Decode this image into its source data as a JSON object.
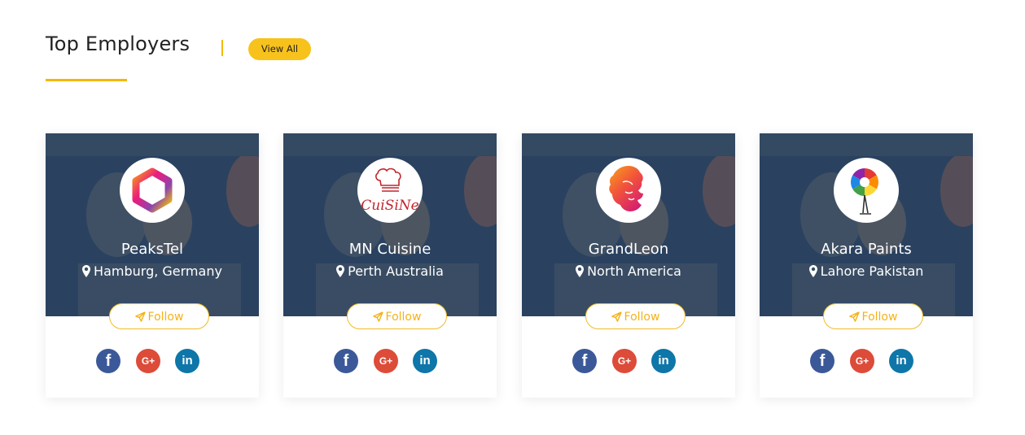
{
  "section": {
    "title": "Top Employers",
    "view_all_label": "View All",
    "accent_color": "#f5b800"
  },
  "employers": [
    {
      "name": "PeaksTel",
      "location": "Hamburg, Germany",
      "logo_icon": "hexagon-gradient-logo",
      "follow_label": "Follow"
    },
    {
      "name": "MN Cuisine",
      "location": "Perth Australia",
      "logo_icon": "chef-hat-cuisine-logo",
      "logo_text": "CuiSiNe",
      "follow_label": "Follow"
    },
    {
      "name": "GrandLeon",
      "location": "North America",
      "logo_icon": "lion-head-logo",
      "follow_label": "Follow"
    },
    {
      "name": "Akara Paints",
      "location": "Lahore Pakistan",
      "logo_icon": "color-wheel-flamingo-logo",
      "follow_label": "Follow"
    }
  ],
  "social": {
    "facebook_glyph": "f",
    "google_plus_glyph": "G+",
    "linkedin_glyph": "in",
    "facebook_color": "#3b5998",
    "google_plus_color": "#dd4b39",
    "linkedin_color": "#0e76a8"
  }
}
